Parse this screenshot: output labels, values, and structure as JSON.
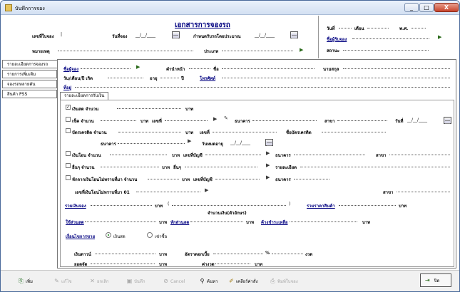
{
  "window": {
    "title": "บันทึกการจอง",
    "minimize": "_",
    "maximize": "□",
    "close": "X"
  },
  "header": {
    "doc_title": "เอกสารการจองรถ",
    "booking_no_label": "เลขที่ใบจอง",
    "booking_no_value": "|",
    "booking_date_label": "วันที่จอง",
    "delivery_est_label": "กำหนดรับรถโดยประมาณ",
    "remark_label": "หมายเหตุ",
    "type_label": "ประเภท",
    "date_placeholder": "__/__/____",
    "date_label": "วันที่",
    "month_label": "เดือน",
    "year_label": "พ.ศ.",
    "salesman_label": "ชื่อผู้รับจอง",
    "status_label": "สถานะ"
  },
  "side_tabs": [
    {
      "label": "รายละเอียดการจองรถ",
      "active": true
    },
    {
      "label": "รายการเพิ่มเติม",
      "active": false
    },
    {
      "label": "จองรถหลายคัน",
      "active": false
    },
    {
      "label": "สินค้า PSS",
      "active": false
    }
  ],
  "customer": {
    "name_link": "ชื่อผู้จอง",
    "prefix_label": "คำนำหน้า",
    "firstname_label": "ชื่อ",
    "lastname_label": "นามสกุล",
    "birth_label": "วัน/เดือน/ปี เกิด",
    "age_label": "อายุ",
    "year_unit": "ปี",
    "phone_link": "โทรศัพท์",
    "address_link": "ที่อยู่"
  },
  "payment_tab": "รายละเอียดการรับเงิน",
  "payment": {
    "cash_label": "เงินสด จำนวน",
    "baht": "บาท",
    "cheque_label": "เช็ค จำนวน",
    "number_label": "เลขที่",
    "bank_label": "ธนาคาร",
    "branch_label": "สาขา",
    "date_label": "วันที่",
    "card_label": "บัตรเครดิต จำนวน",
    "card_name_label": "ชื่อบัตรเครดิต",
    "expiry_label": "วันหมดอายุ",
    "transfer_label": "เงินโอน จำนวน",
    "account_label": "เลขที่บัญชี",
    "other_label": "อื่นๆ จำนวน",
    "other2_label": "อื่นๆ",
    "detail_label": "รายละเอียด",
    "deduct_label": "หักจากเงินโอนไม่ทราบที่มา จำนวน",
    "unknown_no_label": "เลขที่เงินโอนไม่ทราบที่มา 01",
    "total_label": "รวมเงินจอง",
    "words_label": "จำนวนเงิน(ตัวอักษร)",
    "price_label": "รวมราคาสินค้า",
    "discount_label": "ใช้ส่วนลด",
    "down_label": "หักส่วนลด",
    "remain_label": "ค้างชำระเหลือ",
    "condition_label": "เงื่อนไขการขาย",
    "opt_cash": "เงินสด",
    "opt_hire": "เช่าซื้อ",
    "down_payment_label": "เงินดาวน์",
    "interest_label": "อัตราดอกเบี้ย",
    "percent": "%",
    "installment_label": "งวด",
    "balance_label": "ยอดจัด",
    "monthly_label": "ค่างวด"
  },
  "toolbar": {
    "add": "เพิ่ม",
    "edit": "แก้ไข",
    "cancel_doc": "ยกเลิก",
    "save": "บันทึก",
    "cancel": "Cancel",
    "search": "ค้นหา",
    "clear": "เคลียร์ค่าสั่ง",
    "print": "พิมพ์ใบจอง",
    "close": "ปิด"
  }
}
